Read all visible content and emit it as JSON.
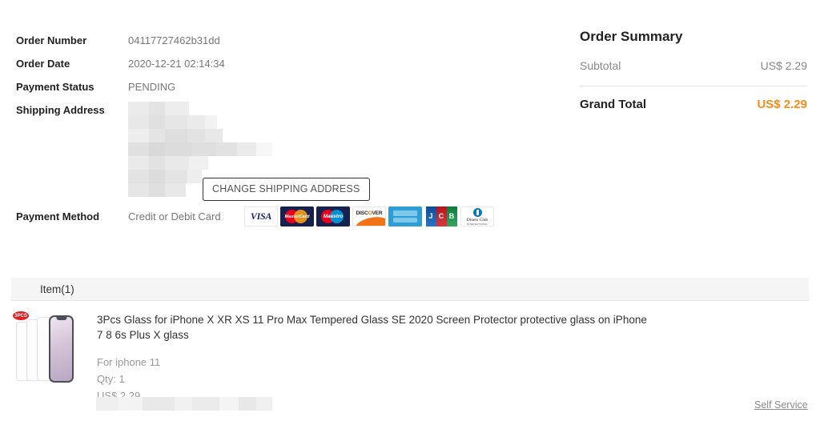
{
  "order_info": {
    "rows": [
      {
        "label": "Order Number",
        "value": "04117727462b31dd"
      },
      {
        "label": "Order Date",
        "value": "2020-12-21 02:14:34"
      },
      {
        "label": "Payment Status",
        "value": "PENDING"
      }
    ],
    "shipping_label": "Shipping Address",
    "shipping_value_redacted": true,
    "change_shipping_address_label": "CHANGE SHIPPING ADDRESS"
  },
  "payment_method": {
    "label": "Payment Method",
    "value": "Credit or Debit Card",
    "cards": [
      {
        "name": "visa",
        "text": "VISA"
      },
      {
        "name": "mastercard",
        "text": "MasterCard"
      },
      {
        "name": "maestro",
        "text": "Maestro"
      },
      {
        "name": "discover",
        "text": "DISCOVER"
      },
      {
        "name": "amex",
        "text": "AMERICAN EXPRESS"
      },
      {
        "name": "jcb",
        "text": "JCB"
      },
      {
        "name": "diners-club",
        "text": "Diners Club"
      }
    ]
  },
  "order_summary": {
    "title": "Order Summary",
    "subtotal_label": "Subtotal",
    "subtotal_value": "US$ 2.29",
    "grand_total_label": "Grand Total",
    "grand_total_value": "US$ 2.29",
    "accent_color": "#fa8c16"
  },
  "items_section": {
    "header_label": "Item(1)",
    "item": {
      "title": "3Pcs Glass for iPhone X XR XS 11 Pro Max Tempered Glass SE 2020 Screen Protector protective glass on iPhone 7 8 6s Plus X glass",
      "variant": "For iphone 11",
      "qty": "Qty: 1",
      "price": "US$ 2.29",
      "thumbnail_badge": "3PCS"
    },
    "self_service_label": "Self Service"
  }
}
